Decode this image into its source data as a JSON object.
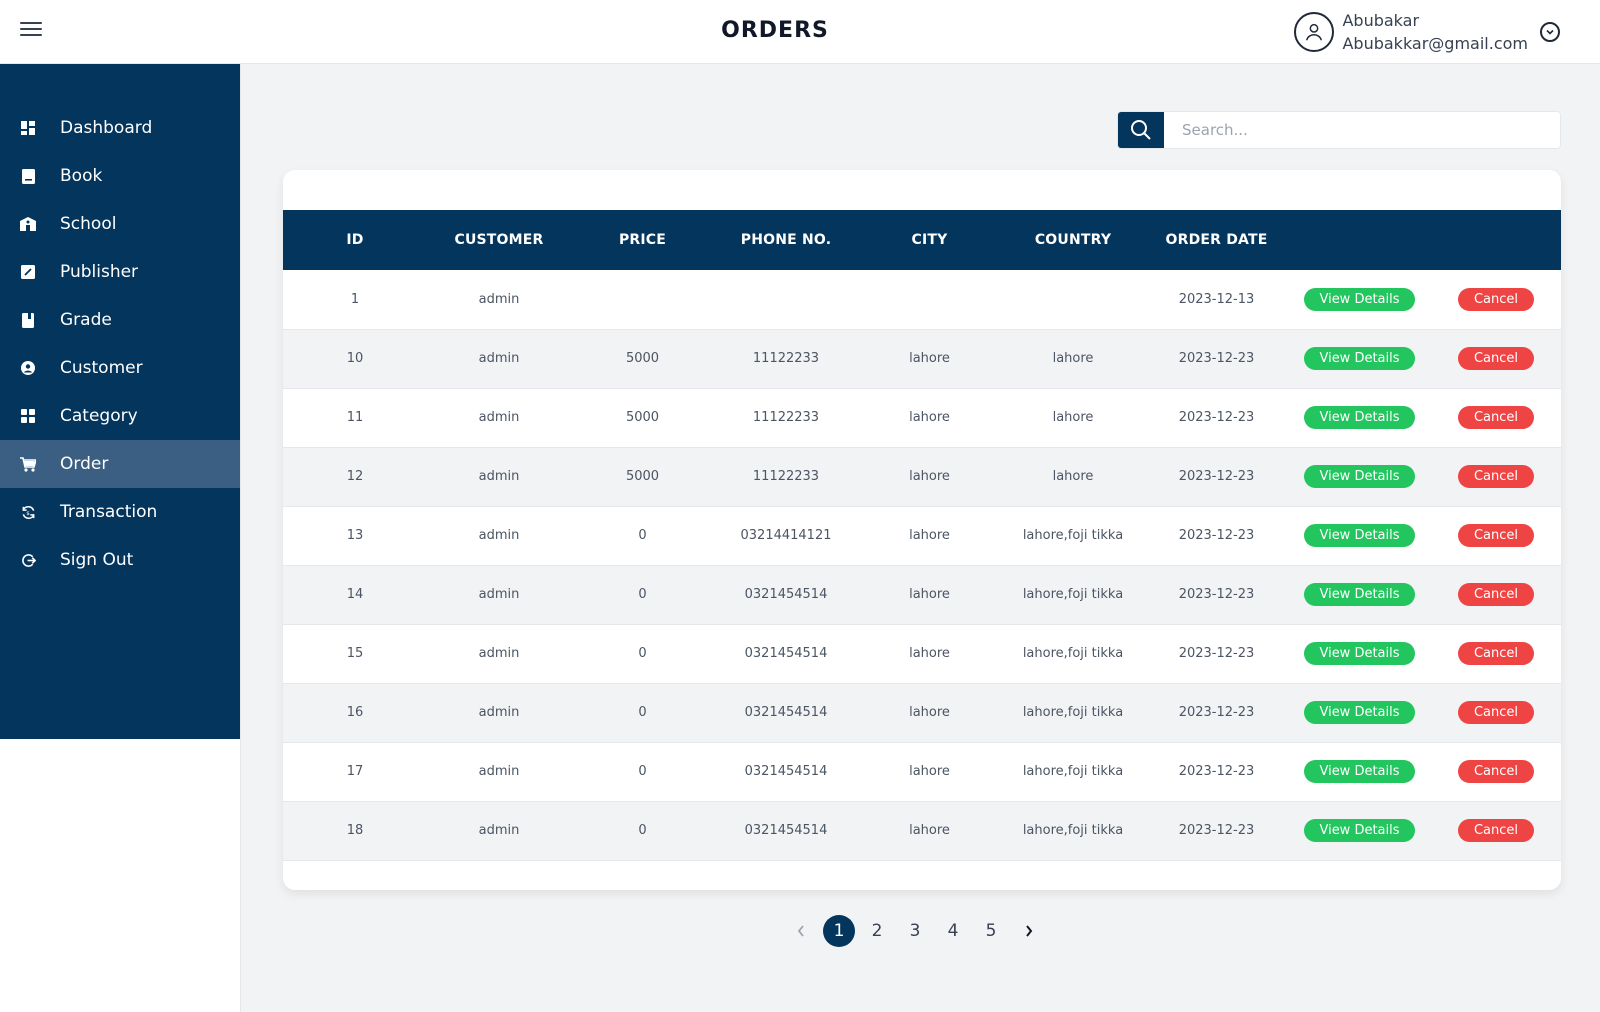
{
  "header": {
    "title": "ORDERS",
    "user_name": "Abubakar",
    "user_email": "Abubakkar@gmail.com"
  },
  "sidebar": {
    "items": [
      {
        "label": "Dashboard",
        "icon": "dashboard-icon",
        "active": false
      },
      {
        "label": "Book",
        "icon": "book-icon",
        "active": false
      },
      {
        "label": "School",
        "icon": "school-icon",
        "active": false
      },
      {
        "label": "Publisher",
        "icon": "publisher-icon",
        "active": false
      },
      {
        "label": "Grade",
        "icon": "grade-icon",
        "active": false
      },
      {
        "label": "Customer",
        "icon": "customer-icon",
        "active": false
      },
      {
        "label": "Category",
        "icon": "category-icon",
        "active": false
      },
      {
        "label": "Order",
        "icon": "cart-icon",
        "active": true
      },
      {
        "label": "Transaction",
        "icon": "transaction-icon",
        "active": false
      },
      {
        "label": "Sign Out",
        "icon": "sign-out-icon",
        "active": false
      }
    ]
  },
  "search": {
    "placeholder": "Search..."
  },
  "table": {
    "columns": [
      "ID",
      "CUSTOMER",
      "PRICE",
      "PHONE NO.",
      "CITY",
      "COUNTRY",
      "ORDER DATE"
    ],
    "view_label": "View Details",
    "cancel_label": "Cancel",
    "rows": [
      [
        "1",
        "admin",
        "",
        "",
        "",
        "",
        "2023-12-13"
      ],
      [
        "10",
        "admin",
        "5000",
        "11122233",
        "lahore",
        "lahore",
        "2023-12-23"
      ],
      [
        "11",
        "admin",
        "5000",
        "11122233",
        "lahore",
        "lahore",
        "2023-12-23"
      ],
      [
        "12",
        "admin",
        "5000",
        "11122233",
        "lahore",
        "lahore",
        "2023-12-23"
      ],
      [
        "13",
        "admin",
        "0",
        "03214414121",
        "lahore",
        "lahore,foji tikka",
        "2023-12-23"
      ],
      [
        "14",
        "admin",
        "0",
        "0321454514",
        "lahore",
        "lahore,foji tikka",
        "2023-12-23"
      ],
      [
        "15",
        "admin",
        "0",
        "0321454514",
        "lahore",
        "lahore,foji tikka",
        "2023-12-23"
      ],
      [
        "16",
        "admin",
        "0",
        "0321454514",
        "lahore",
        "lahore,foji tikka",
        "2023-12-23"
      ],
      [
        "17",
        "admin",
        "0",
        "0321454514",
        "lahore",
        "lahore,foji tikka",
        "2023-12-23"
      ],
      [
        "18",
        "admin",
        "0",
        "0321454514",
        "lahore",
        "lahore,foji tikka",
        "2023-12-23"
      ]
    ]
  },
  "pagination": {
    "pages": [
      "1",
      "2",
      "3",
      "4",
      "5"
    ],
    "current": "1"
  },
  "colors": {
    "primary": "#04355d",
    "active_item": "#3a5f82",
    "view_button": "#22c55e",
    "cancel_button": "#ef4444"
  }
}
